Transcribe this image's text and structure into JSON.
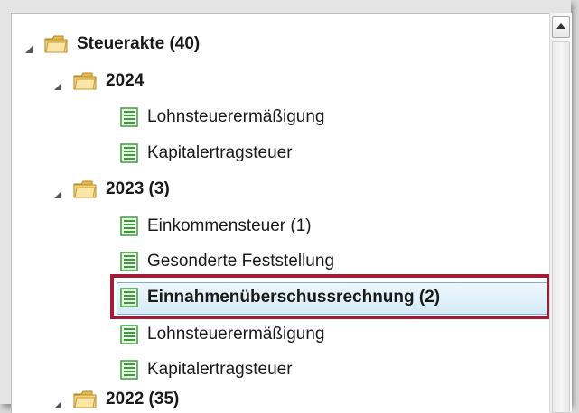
{
  "tree": {
    "root": {
      "label": "Steuerakte (40)"
    },
    "items": [
      {
        "label": "2024"
      },
      {
        "label": "Lohnsteuerermäßigung"
      },
      {
        "label": "Kapitalertragsteuer"
      },
      {
        "label": "2023 (3)"
      },
      {
        "label": "Einkommensteuer (1)"
      },
      {
        "label": "Gesonderte Feststellung"
      },
      {
        "label": "Einnahmenüberschussrechnung (2)"
      },
      {
        "label": "Lohnsteuerermäßigung"
      },
      {
        "label": "Kapitalertragsteuer"
      },
      {
        "label": "2022 (35)"
      }
    ]
  },
  "colors": {
    "highlight_border": "#a01c37",
    "selection_fill": "#d5ebf8",
    "folder": "#f3d27a",
    "document": "#3f9b3f"
  }
}
